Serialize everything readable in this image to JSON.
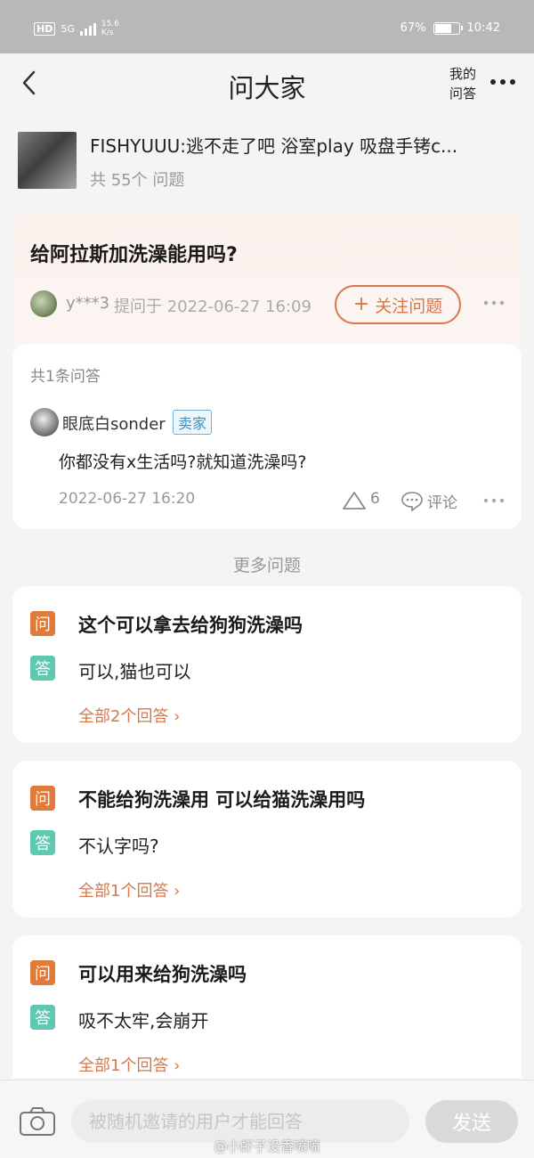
{
  "status_bar": {
    "network": "HD",
    "signal": "5G",
    "speed": "15.6\nK/s",
    "battery_text": "67%",
    "battery_level": 0.67,
    "time": "10:42"
  },
  "nav": {
    "title": "问大家",
    "my_answers": "我的\n问答"
  },
  "product": {
    "name": "FISHYUUU:逃不走了吧 浴室play 吸盘手铐c...",
    "question_count": "共 55个 问题"
  },
  "question": {
    "title": "给阿拉斯加洗澡能用吗?",
    "asker": "y***3",
    "asked_at": "提问于 2022-06-27 16:09",
    "follow_label": "关注问题"
  },
  "answers": {
    "count_label": "共1条问答",
    "items": [
      {
        "user": "眼底白sonder",
        "badge": "卖家",
        "text": "你都没有x生活吗?就知道洗澡吗?",
        "time": "2022-06-27 16:20",
        "likes": "6",
        "comment_label": "评论"
      }
    ]
  },
  "more_questions": {
    "heading": "更多问题",
    "q_badge": "问",
    "a_badge": "答",
    "items": [
      {
        "question": "这个可以拿去给狗狗洗澡吗",
        "answer": "可以,猫也可以",
        "link": "全部2个回答 ›"
      },
      {
        "question": "不能给狗洗澡用 可以给猫洗澡用吗",
        "answer": "不认字吗?",
        "link": "全部1个回答 ›"
      },
      {
        "question": "可以用来给狗洗澡吗",
        "answer": "吸不太牢,会崩开",
        "link": "全部1个回答 ›"
      }
    ]
  },
  "bottom": {
    "input_placeholder": "被随机邀请的用户才能回答",
    "send_label": "发送",
    "watermark": "@小虾子没香喷喷"
  },
  "colors": {
    "accent": "#d8774b",
    "question_badge": "#e07b3c",
    "answer_badge": "#5fc8b0",
    "seller_badge": "#3a92c4"
  }
}
